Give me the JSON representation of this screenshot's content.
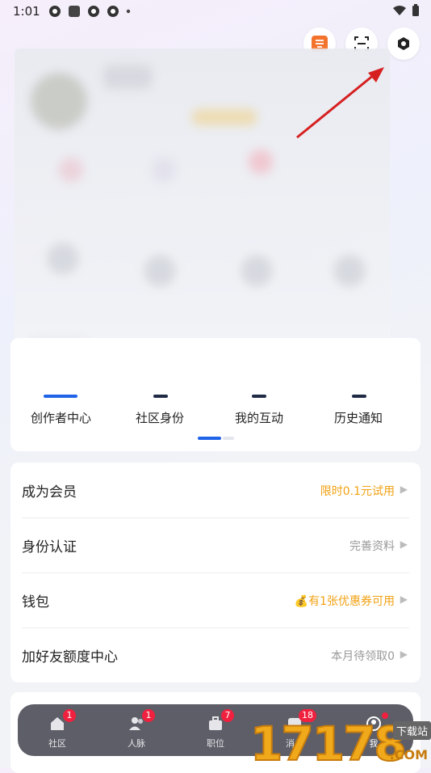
{
  "status_bar": {
    "time": "1:01"
  },
  "tools": {
    "items": [
      {
        "label": "创作者中心"
      },
      {
        "label": "社区身份"
      },
      {
        "label": "我的互动"
      },
      {
        "label": "历史通知"
      }
    ]
  },
  "menu": {
    "rows": [
      {
        "title": "成为会员",
        "value": "限时0.1元试用",
        "accent": true
      },
      {
        "title": "身份认证",
        "value": "完善资料",
        "accent": false
      },
      {
        "title": "钱包",
        "value": "💰有1张优惠券可用",
        "accent": true
      },
      {
        "title": "加好友额度中心",
        "value": "本月待领取0",
        "accent": false
      }
    ]
  },
  "tabbar": {
    "tabs": [
      {
        "label": "社区",
        "badge": "1"
      },
      {
        "label": "人脉",
        "badge": "1"
      },
      {
        "label": "职位",
        "badge": "7"
      },
      {
        "label": "消息",
        "badge": "18"
      },
      {
        "label": "我",
        "badge": ""
      }
    ]
  },
  "watermark": {
    "number": "17178",
    "tag": "下载站",
    "suffix": ".COM"
  },
  "colors": {
    "accent": "#f2a113",
    "badge": "#f0213f",
    "primary": "#1f63e8",
    "tabbar_bg": "#5d5e67"
  }
}
